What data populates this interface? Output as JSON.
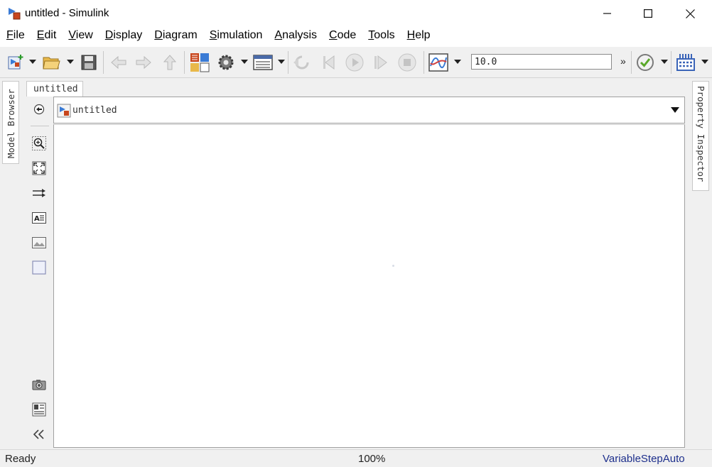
{
  "window": {
    "title": "untitled - Simulink"
  },
  "menu": [
    "File",
    "Edit",
    "View",
    "Display",
    "Diagram",
    "Simulation",
    "Analysis",
    "Code",
    "Tools",
    "Help"
  ],
  "toolbar": {
    "stop_time": "10.0",
    "more": "»"
  },
  "side_tabs": {
    "left": "Model Browser",
    "right": "Property Inspector"
  },
  "document_tab": "untitled",
  "breadcrumb": "untitled",
  "status": {
    "left": "Ready",
    "zoom": "100%",
    "solver": "VariableStepAuto"
  },
  "colors": {
    "solver_text": "#1d2f8c",
    "toolbar_bg": "#f0f0f0"
  }
}
